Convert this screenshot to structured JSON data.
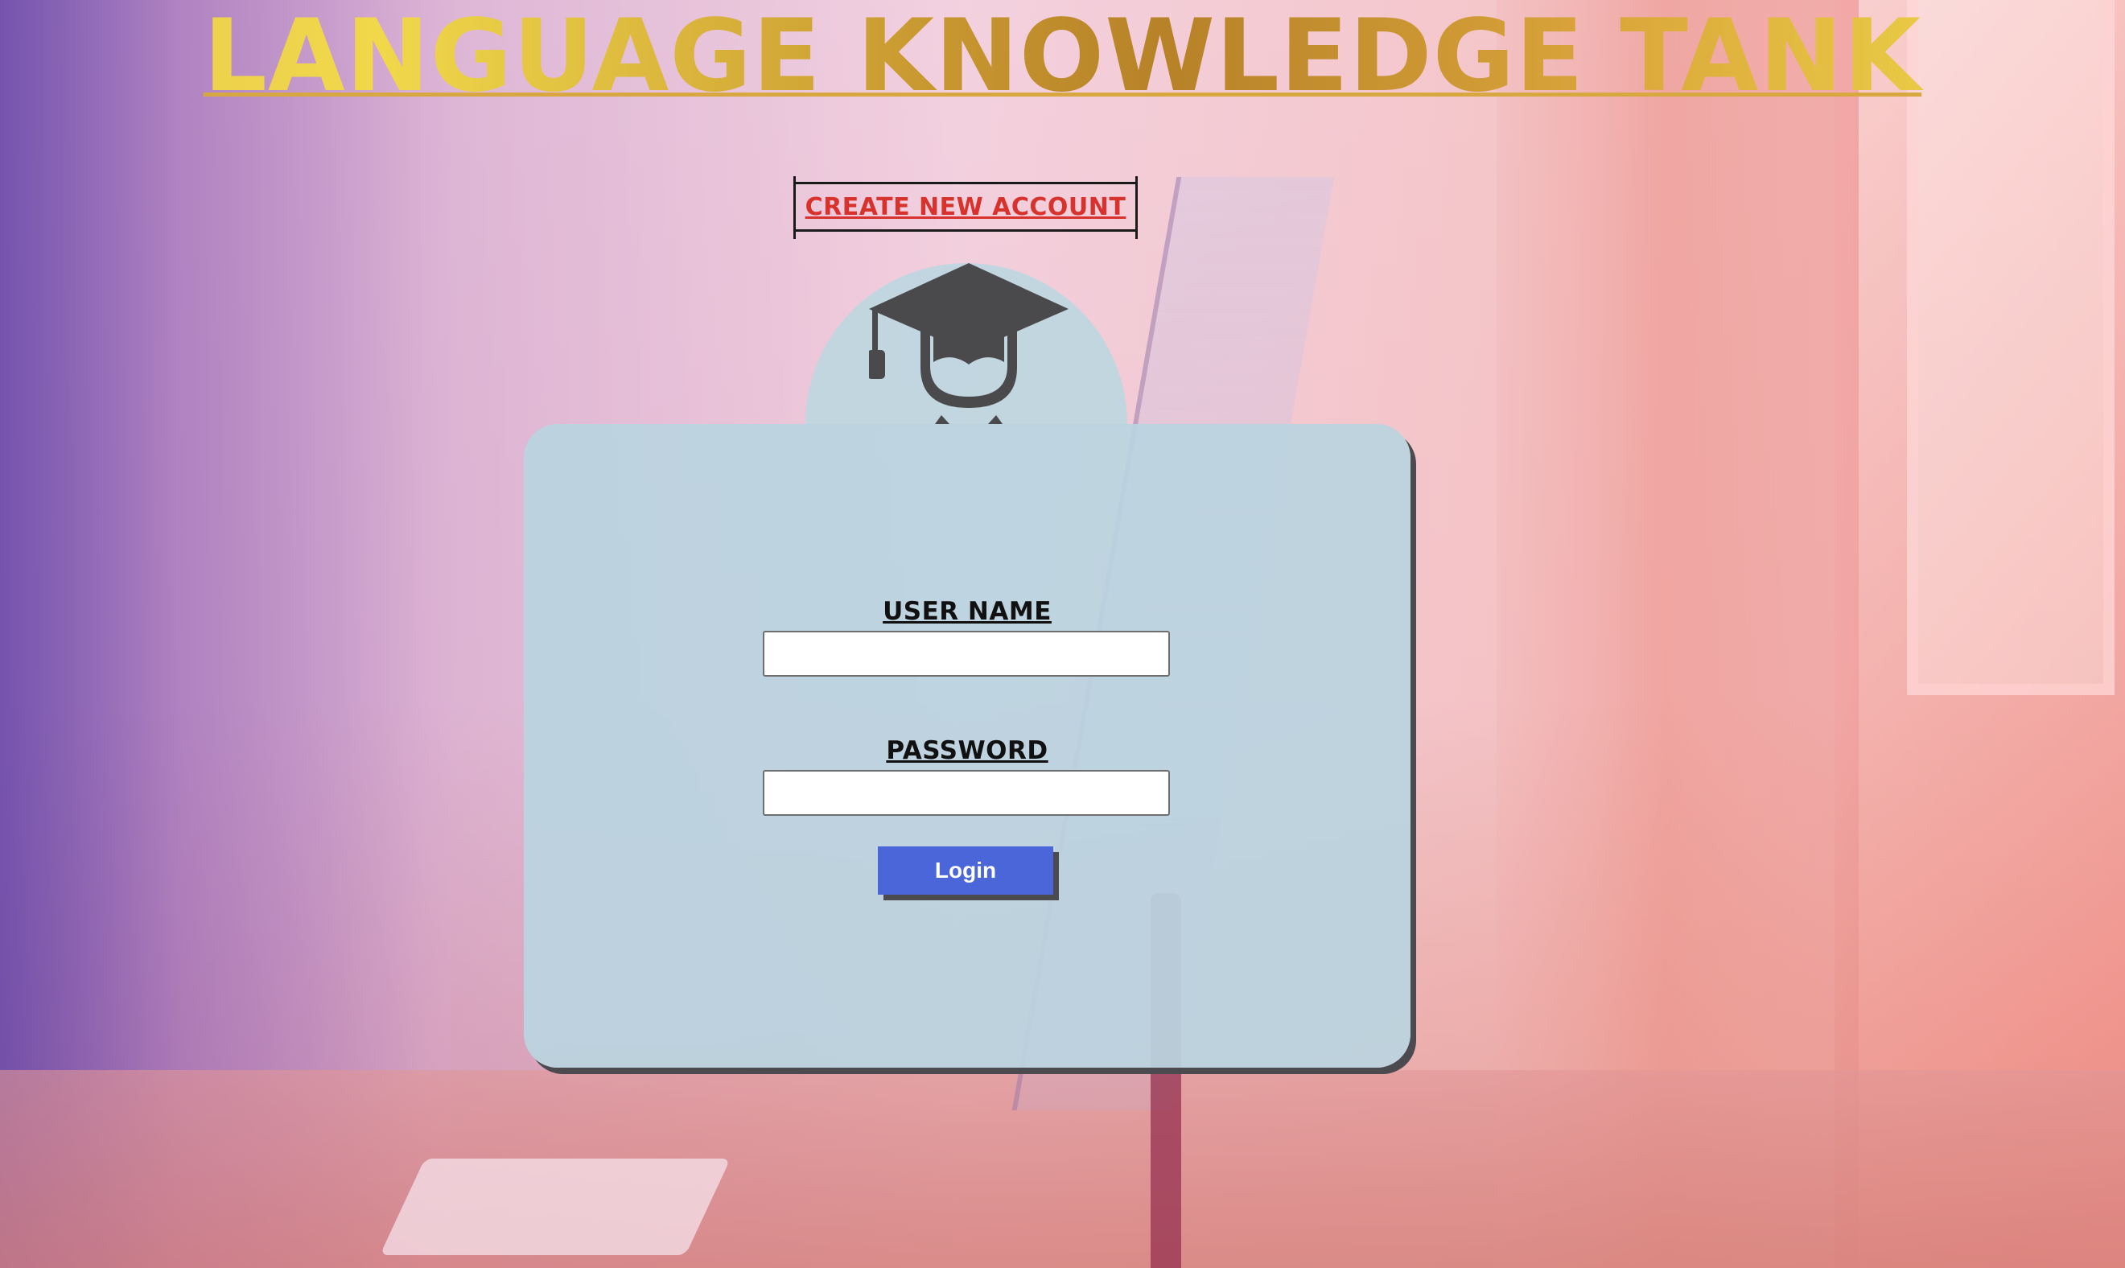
{
  "header": {
    "title": "LANGUAGE KNOWLEDGE TANK"
  },
  "links": {
    "create_account": "CREATE NEW ACCOUNT"
  },
  "login_form": {
    "avatar_icon": "graduation-student-icon",
    "username_label": "USER NAME",
    "username_value": "",
    "password_label": "PASSWORD",
    "password_value": "",
    "login_button_label": "Login"
  },
  "colors": {
    "title_gold": "#d9a43a",
    "link_red": "#d8322c",
    "button_blue": "#4a66d8",
    "card_bg": "#bad4e0",
    "shadow": "#4a4a4f"
  }
}
